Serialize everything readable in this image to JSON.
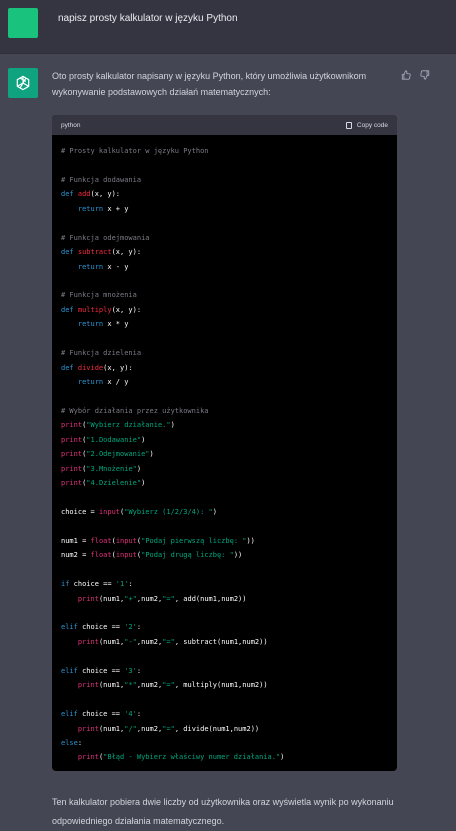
{
  "user_message": {
    "text": "napisz prosty kalkulator w języku Python"
  },
  "assistant": {
    "intro": "Oto prosty kalkulator napisany w języku Python, który umożliwia użytkownikom wykonywanie podstawowych działań matematycznych:",
    "outro": "Ten kalkulator pobiera dwie liczby od użytkownika oraz wyświetla wynik po wykonaniu odpowiedniego działania matematycznego.",
    "feedback": {
      "up_icon": "thumbs-up-icon",
      "down_icon": "thumbs-down-icon"
    }
  },
  "code_block": {
    "language": "python",
    "copy_label": "Copy code",
    "lines": [
      [
        {
          "t": "# Prosty kalkulator w języku Python",
          "c": "c"
        }
      ],
      [],
      [
        {
          "t": "# Funkcja dodawania",
          "c": "c"
        }
      ],
      [
        {
          "t": "def ",
          "c": "k"
        },
        {
          "t": "add",
          "c": "f"
        },
        {
          "t": "(x, y):",
          "c": ""
        }
      ],
      [
        {
          "t": "    return",
          "c": "k"
        },
        {
          "t": " x + y",
          "c": ""
        }
      ],
      [],
      [
        {
          "t": "# Funkcja odejmowania",
          "c": "c"
        }
      ],
      [
        {
          "t": "def ",
          "c": "k"
        },
        {
          "t": "subtract",
          "c": "f"
        },
        {
          "t": "(x, y):",
          "c": ""
        }
      ],
      [
        {
          "t": "    return",
          "c": "k"
        },
        {
          "t": " x - y",
          "c": ""
        }
      ],
      [],
      [
        {
          "t": "# Funkcja mnożenia",
          "c": "c"
        }
      ],
      [
        {
          "t": "def ",
          "c": "k"
        },
        {
          "t": "multiply",
          "c": "f"
        },
        {
          "t": "(x, y):",
          "c": ""
        }
      ],
      [
        {
          "t": "    return",
          "c": "k"
        },
        {
          "t": " x * y",
          "c": ""
        }
      ],
      [],
      [
        {
          "t": "# Funkcja dzielenia",
          "c": "c"
        }
      ],
      [
        {
          "t": "def ",
          "c": "k"
        },
        {
          "t": "divide",
          "c": "f"
        },
        {
          "t": "(x, y):",
          "c": ""
        }
      ],
      [
        {
          "t": "    return",
          "c": "k"
        },
        {
          "t": " x / y",
          "c": ""
        }
      ],
      [],
      [
        {
          "t": "# Wybór działania przez użytkownika",
          "c": "c"
        }
      ],
      [
        {
          "t": "print",
          "c": "n"
        },
        {
          "t": "(",
          "c": ""
        },
        {
          "t": "\"Wybierz działanie.\"",
          "c": "s"
        },
        {
          "t": ")",
          "c": ""
        }
      ],
      [
        {
          "t": "print",
          "c": "n"
        },
        {
          "t": "(",
          "c": ""
        },
        {
          "t": "\"1.Dodawanie\"",
          "c": "s"
        },
        {
          "t": ")",
          "c": ""
        }
      ],
      [
        {
          "t": "print",
          "c": "n"
        },
        {
          "t": "(",
          "c": ""
        },
        {
          "t": "\"2.Odejmowanie\"",
          "c": "s"
        },
        {
          "t": ")",
          "c": ""
        }
      ],
      [
        {
          "t": "print",
          "c": "n"
        },
        {
          "t": "(",
          "c": ""
        },
        {
          "t": "\"3.Mnożenie\"",
          "c": "s"
        },
        {
          "t": ")",
          "c": ""
        }
      ],
      [
        {
          "t": "print",
          "c": "n"
        },
        {
          "t": "(",
          "c": ""
        },
        {
          "t": "\"4.Dzielenie\"",
          "c": "s"
        },
        {
          "t": ")",
          "c": ""
        }
      ],
      [],
      [
        {
          "t": "choice = ",
          "c": ""
        },
        {
          "t": "input",
          "c": "n"
        },
        {
          "t": "(",
          "c": ""
        },
        {
          "t": "\"Wybierz (1/2/3/4): \"",
          "c": "s"
        },
        {
          "t": ")",
          "c": ""
        }
      ],
      [],
      [
        {
          "t": "num1 = ",
          "c": ""
        },
        {
          "t": "float",
          "c": "n"
        },
        {
          "t": "(",
          "c": ""
        },
        {
          "t": "input",
          "c": "n"
        },
        {
          "t": "(",
          "c": ""
        },
        {
          "t": "\"Podaj pierwszą liczbę: \"",
          "c": "s"
        },
        {
          "t": "))",
          "c": ""
        }
      ],
      [
        {
          "t": "num2 = ",
          "c": ""
        },
        {
          "t": "float",
          "c": "n"
        },
        {
          "t": "(",
          "c": ""
        },
        {
          "t": "input",
          "c": "n"
        },
        {
          "t": "(",
          "c": ""
        },
        {
          "t": "\"Podaj drugą liczbę: \"",
          "c": "s"
        },
        {
          "t": "))",
          "c": ""
        }
      ],
      [],
      [
        {
          "t": "if",
          "c": "k"
        },
        {
          "t": " choice == ",
          "c": ""
        },
        {
          "t": "'1'",
          "c": "s"
        },
        {
          "t": ":",
          "c": ""
        }
      ],
      [
        {
          "t": "    ",
          "c": ""
        },
        {
          "t": "print",
          "c": "n"
        },
        {
          "t": "(num1,",
          "c": ""
        },
        {
          "t": "\"+\"",
          "c": "s"
        },
        {
          "t": ",num2,",
          "c": ""
        },
        {
          "t": "\"=\"",
          "c": "s"
        },
        {
          "t": ", add(num1,num2))",
          "c": ""
        }
      ],
      [],
      [
        {
          "t": "elif",
          "c": "k"
        },
        {
          "t": " choice == ",
          "c": ""
        },
        {
          "t": "'2'",
          "c": "s"
        },
        {
          "t": ":",
          "c": ""
        }
      ],
      [
        {
          "t": "    ",
          "c": ""
        },
        {
          "t": "print",
          "c": "n"
        },
        {
          "t": "(num1,",
          "c": ""
        },
        {
          "t": "\"-\"",
          "c": "s"
        },
        {
          "t": ",num2,",
          "c": ""
        },
        {
          "t": "\"=\"",
          "c": "s"
        },
        {
          "t": ", subtract(num1,num2))",
          "c": ""
        }
      ],
      [],
      [
        {
          "t": "elif",
          "c": "k"
        },
        {
          "t": " choice == ",
          "c": ""
        },
        {
          "t": "'3'",
          "c": "s"
        },
        {
          "t": ":",
          "c": ""
        }
      ],
      [
        {
          "t": "    ",
          "c": ""
        },
        {
          "t": "print",
          "c": "n"
        },
        {
          "t": "(num1,",
          "c": ""
        },
        {
          "t": "\"*\"",
          "c": "s"
        },
        {
          "t": ",num2,",
          "c": ""
        },
        {
          "t": "\"=\"",
          "c": "s"
        },
        {
          "t": ", multiply(num1,num2))",
          "c": ""
        }
      ],
      [],
      [
        {
          "t": "elif",
          "c": "k"
        },
        {
          "t": " choice == ",
          "c": ""
        },
        {
          "t": "'4'",
          "c": "s"
        },
        {
          "t": ":",
          "c": ""
        }
      ],
      [
        {
          "t": "    ",
          "c": ""
        },
        {
          "t": "print",
          "c": "n"
        },
        {
          "t": "(num1,",
          "c": ""
        },
        {
          "t": "\"/\"",
          "c": "s"
        },
        {
          "t": ",num2,",
          "c": ""
        },
        {
          "t": "\"=\"",
          "c": "s"
        },
        {
          "t": ", divide(num1,num2))",
          "c": ""
        }
      ],
      [
        {
          "t": "else",
          "c": "k"
        },
        {
          "t": ":",
          "c": ""
        }
      ],
      [
        {
          "t": "    ",
          "c": ""
        },
        {
          "t": "print",
          "c": "n"
        },
        {
          "t": "(",
          "c": ""
        },
        {
          "t": "\"Błąd - Wybierz właściwy numer działania.\"",
          "c": "s"
        },
        {
          "t": ")",
          "c": ""
        }
      ]
    ]
  },
  "colors": {
    "page_bg": "#444654",
    "user_row_bg": "#343541",
    "user_avatar": "#19c37d",
    "assistant_avatar": "#10a37f",
    "code_bg": "#000000",
    "comment": "#7b7b86",
    "keyword": "#2e95d3",
    "function_name": "#f22c3d",
    "string": "#00a67d",
    "builtin": "#df3079"
  }
}
